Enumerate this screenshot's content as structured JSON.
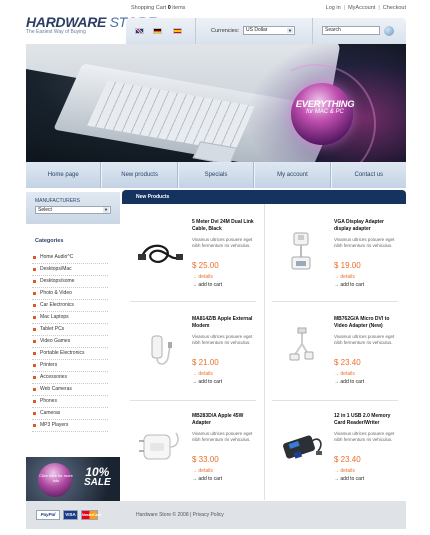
{
  "brand": {
    "name_a": "HARDWARE",
    "name_b": "STORE",
    "tagline": "The Easiest Way of Buying"
  },
  "header": {
    "cart_prefix": "Shopping Cart",
    "cart_count": "0",
    "cart_suffix": "items",
    "links": [
      "Log in",
      "MyAccount",
      "Checkout"
    ],
    "currency_label": "Currencies:",
    "currency_value": "US Dollar",
    "search_placeholder": "Search"
  },
  "banner": {
    "headline": "EVERYTHING",
    "sub": "for MAC & PC"
  },
  "nav": [
    "Home page",
    "New products",
    "Specials",
    "My account",
    "Contact us"
  ],
  "manufacturers": {
    "title": "MANUFACTURERS",
    "selected": "Select"
  },
  "categories": {
    "title": "Categories",
    "items": [
      "Home Audio^C",
      "Desktops/Mac",
      "Desktops/some",
      "Photo & Video",
      "Car Electronics",
      "Mac Laptops",
      "Tablet PCs",
      "Video Games",
      "Portable Electronics",
      "Printers",
      "Accessories",
      "Web Cameras",
      "Phones",
      "Cameras",
      "MP3 Players"
    ]
  },
  "promo": {
    "small": "Click here for more info",
    "percent": "10%",
    "sale": "SALE"
  },
  "main": {
    "title": "New Products",
    "products": [
      {
        "name": "5 Meter Dvi 24M Dual Link Cable, Black",
        "desc": "Vivamus ultrices posuere eget nibh fermentum ris vehiculus.",
        "price": "$ 25.00",
        "details": "details",
        "add": "add to cart",
        "icon": "cable-icon"
      },
      {
        "name": "VGA Display Adapter display adapter",
        "desc": "Vivamus ultrices posuere eget nibh fermentum ris vehiculus.",
        "price": "$ 19.00",
        "details": "details",
        "add": "add to cart",
        "icon": "vga-adapter-icon"
      },
      {
        "name": "MA814Z/B Apple External Modem",
        "desc": "Vivamus ultrices posuere eget nibh fermentum ris vehiculus.",
        "price": "$ 21.00",
        "details": "details",
        "add": "add to cart",
        "icon": "modem-icon"
      },
      {
        "name": "MB762G/A Micro DVI to Video Adapter (New)",
        "desc": "Vivamus ultrices posuere eget nibh fermentum ris vehiculus.",
        "price": "$ 23.40",
        "details": "details",
        "add": "add to cart",
        "icon": "dvi-adapter-icon"
      },
      {
        "name": "MB283D/A Apple 45W Adapter",
        "desc": "Vivamus ultrices posuere eget nibh fermentum ris vehiculus.",
        "price": "$ 33.00",
        "details": "details",
        "add": "add to cart",
        "icon": "power-adapter-icon"
      },
      {
        "name": "12 in 1 USB 2.0 Memory Card Reader/Writer",
        "desc": "Vivamus ultrices posuere eget nibh fermentum ris vehiculus.",
        "price": "$ 23.40",
        "details": "details",
        "add": "add to cart",
        "icon": "card-reader-icon"
      }
    ]
  },
  "footer": {
    "text": "Hardware Store © 2008 | Privacy Policy",
    "paypal": "PayPal",
    "visa": "VISA",
    "mastercard": "MasterCard"
  }
}
